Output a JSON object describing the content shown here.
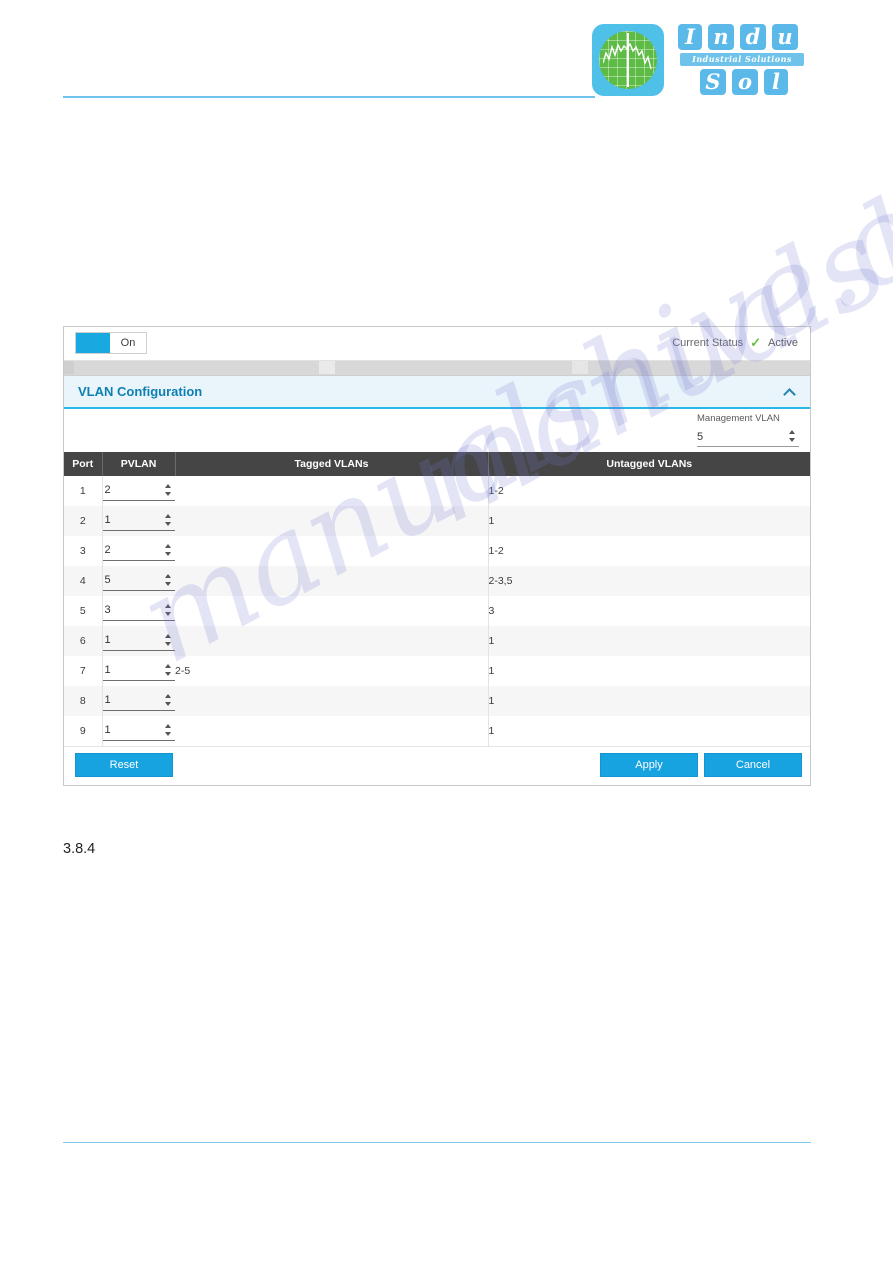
{
  "brand": {
    "name_line1": "Indu",
    "name_line2": "Sol",
    "tagline": "Industrial Solutions",
    "letters": [
      "I",
      "n",
      "d",
      "u",
      "S",
      "o",
      "l"
    ],
    "accent_color": "#5ab9e8",
    "globe_color": "#5ebb46"
  },
  "watermark": {
    "text_1": "manualshive.com",
    "text_2": "manualshive.com"
  },
  "panel": {
    "toggle": {
      "label": "On",
      "knob_color": "#17a9e0"
    },
    "status": {
      "label": "Current Status",
      "check_icon": "check-icon",
      "value": "Active",
      "value_color": "#6abf4b"
    },
    "title": "VLAN Configuration",
    "collapse_icon": "chevron-up-icon",
    "management_vlan": {
      "label": "Management VLAN",
      "value": "5",
      "spinner_icon": "spinner-updown-icon"
    },
    "table": {
      "headers": [
        "Port",
        "PVLAN",
        "Tagged VLANs",
        "Untagged VLANs"
      ],
      "rows": [
        {
          "port": "1",
          "pvlan": "2",
          "tagged": "",
          "untagged": "1-2"
        },
        {
          "port": "2",
          "pvlan": "1",
          "tagged": "",
          "untagged": "1"
        },
        {
          "port": "3",
          "pvlan": "2",
          "tagged": "",
          "untagged": "1-2"
        },
        {
          "port": "4",
          "pvlan": "5",
          "tagged": "",
          "untagged": "2-3,5"
        },
        {
          "port": "5",
          "pvlan": "3",
          "tagged": "",
          "untagged": "3"
        },
        {
          "port": "6",
          "pvlan": "1",
          "tagged": "",
          "untagged": "1"
        },
        {
          "port": "7",
          "pvlan": "1",
          "tagged": "2-5",
          "untagged": "1"
        },
        {
          "port": "8",
          "pvlan": "1",
          "tagged": "",
          "untagged": "1"
        },
        {
          "port": "9",
          "pvlan": "1",
          "tagged": "",
          "untagged": "1"
        }
      ]
    },
    "buttons": {
      "reset": "Reset",
      "apply": "Apply",
      "cancel": "Cancel",
      "color": "#17a2e0"
    }
  },
  "document": {
    "section_number": "3.8.4"
  }
}
